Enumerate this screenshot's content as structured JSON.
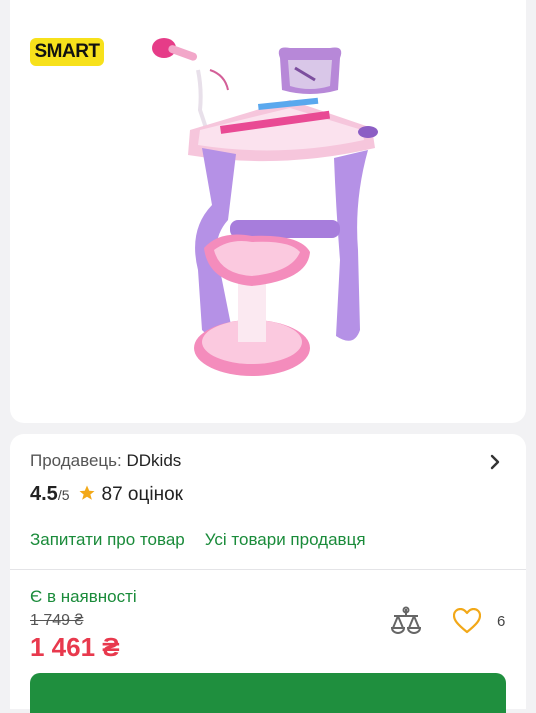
{
  "brand": {
    "logo_text": "SMART"
  },
  "seller": {
    "label": "Продавець:",
    "name": "DDkids"
  },
  "rating": {
    "value": "4.5",
    "max": "/5",
    "reviews": "87 оцінок"
  },
  "links": {
    "ask": "Запитати про товар",
    "all_products": "Усі товари продавця"
  },
  "offer": {
    "availability": "Є в наявності",
    "old_price": "1 749 ₴",
    "price": "1 461 ₴",
    "wishlist_count": "6"
  },
  "colors": {
    "accent_green": "#1a8b3a",
    "price_red": "#e8394d",
    "star": "#f2a818",
    "logo_yellow": "#f7e11b"
  },
  "icons": [
    "chevron-right-icon",
    "star-icon",
    "compare-scales-icon",
    "heart-icon"
  ]
}
